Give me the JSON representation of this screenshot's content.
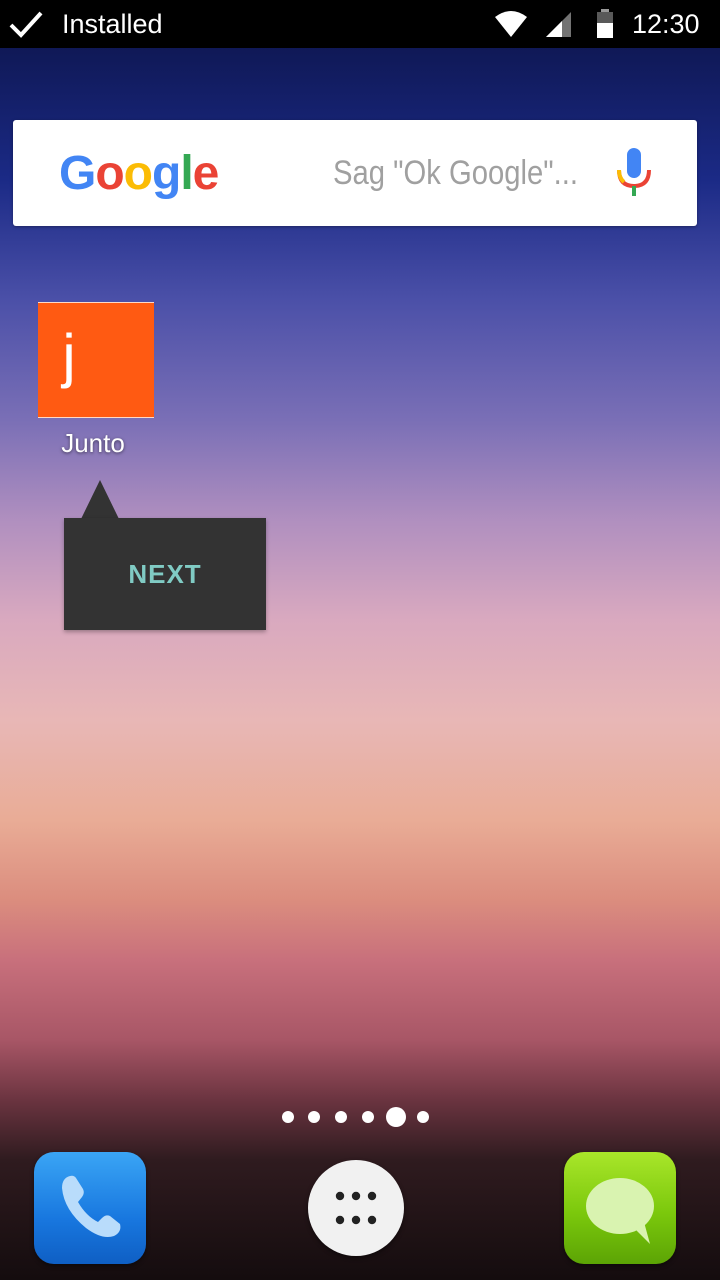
{
  "status_bar": {
    "title": "Installed",
    "time": "12:30",
    "icons": [
      "check-icon",
      "wifi-icon",
      "signal-icon",
      "battery-icon"
    ]
  },
  "search_bar": {
    "logo_text": "Google",
    "logo_letters": [
      {
        "char": "G",
        "color": "#4285F4"
      },
      {
        "char": "o",
        "color": "#EA4335"
      },
      {
        "char": "o",
        "color": "#FBBC05"
      },
      {
        "char": "g",
        "color": "#4285F4"
      },
      {
        "char": "l",
        "color": "#34A853"
      },
      {
        "char": "e",
        "color": "#EA4335"
      }
    ],
    "placeholder": "Sag \"Ok Google\"...",
    "mic_icon": "mic-icon"
  },
  "home": {
    "app": {
      "icon_letter": "j",
      "label": "Junto",
      "color": "#FF5A12"
    },
    "tooltip": {
      "button_label": "NEXT",
      "button_color": "#80CBC4"
    }
  },
  "page_indicator": {
    "count": 6,
    "active_index": 4
  },
  "dock": {
    "items": [
      {
        "name": "phone",
        "icon": "phone-icon"
      },
      {
        "name": "all-apps",
        "icon": "apps-grid-icon"
      },
      {
        "name": "messaging",
        "icon": "message-bubble-icon"
      }
    ]
  }
}
